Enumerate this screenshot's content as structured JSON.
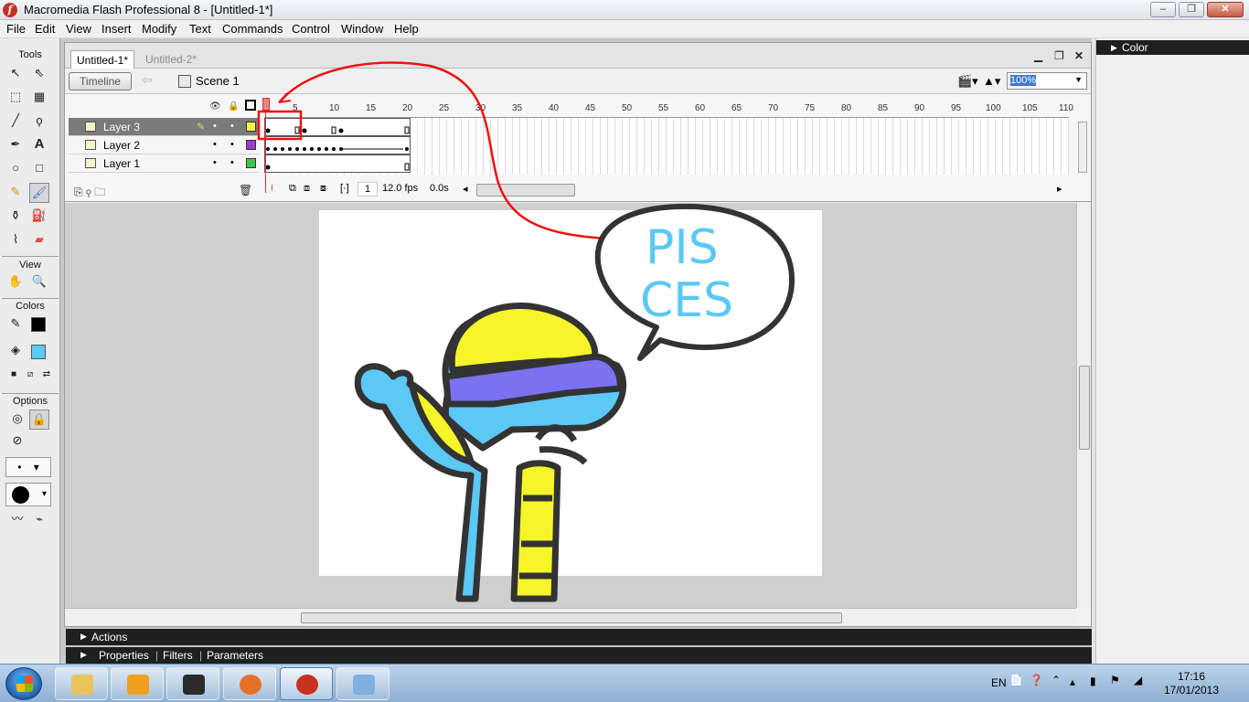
{
  "window": {
    "title": "Macromedia Flash Professional 8 - [Untitled-1*]",
    "minimize": "–",
    "restore": "❐",
    "close": "✕"
  },
  "menu": [
    "File",
    "Edit",
    "View",
    "Insert",
    "Modify",
    "Text",
    "Commands",
    "Control",
    "Window",
    "Help"
  ],
  "tools_panel": {
    "tools_label": "Tools",
    "view_label": "View",
    "colors_label": "Colors",
    "options_label": "Options",
    "colors": {
      "stroke": "#000000",
      "fill": "#5bc8f5"
    }
  },
  "document": {
    "tabs": [
      "Untitled-1*",
      "Untitled-2*"
    ],
    "timeline_button": "Timeline",
    "scene": "Scene 1",
    "zoom": "100%"
  },
  "timeline": {
    "ruler": [
      "5",
      "10",
      "15",
      "20",
      "25",
      "30",
      "35",
      "40",
      "45",
      "50",
      "55",
      "60",
      "65",
      "70",
      "75",
      "80",
      "85",
      "90",
      "95",
      "100",
      "105",
      "110"
    ],
    "layers": [
      {
        "name": "Layer 3",
        "color": "#f5f04a",
        "selected": true
      },
      {
        "name": "Layer 2",
        "color": "#9b3bc8",
        "selected": false
      },
      {
        "name": "Layer 1",
        "color": "#3bc84a",
        "selected": false
      }
    ],
    "current_frame": "1",
    "frame_rate": "12.0 fps",
    "elapsed": "0.0s"
  },
  "stage": {
    "bubble_text_line1": "PIS",
    "bubble_text_line2": "CES"
  },
  "panels": {
    "actions": "Actions",
    "properties": "Properties",
    "filters": "Filters",
    "parameters": "Parameters",
    "color": "Color"
  },
  "taskbar": {
    "lang": "EN",
    "time": "17:16",
    "date": "17/01/2013"
  }
}
